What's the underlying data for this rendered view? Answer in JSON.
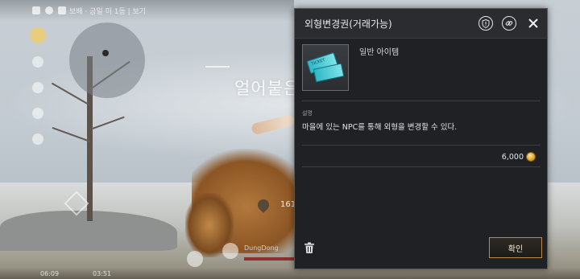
{
  "hud": {
    "status_text": "보배 · 금일 미 1등 | 보기",
    "zone_title": "얼어붙은",
    "location_value": "161",
    "player_name": "DungDong",
    "time_left": "06:09",
    "time_right": "03:51"
  },
  "item_panel": {
    "title": "외형변경권(거래가능)",
    "icons": {
      "info": "exclamation-shield-icon",
      "link": "chain-link-icon",
      "close": "close-icon",
      "delete": "trash-icon",
      "currency": "gold-coin-icon"
    },
    "item_icon_text": "TICKET",
    "item_grade": "일반 아이템",
    "description_label": "설명",
    "description": "마을에 있는 NPC를 통해 외형을 변경할 수 있다.",
    "price": "6,000",
    "confirm_label": "확인"
  },
  "colors": {
    "panel_bg": "#1f2124",
    "header_bg": "#2a2c30",
    "confirm_border": "#b88a47",
    "coin": "#d99a1d"
  }
}
